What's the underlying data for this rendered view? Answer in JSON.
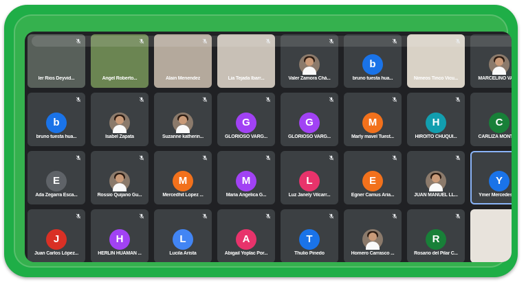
{
  "participants": [
    {
      "name": "ler Rios Deyvid...",
      "type": "video",
      "bg": "#58605a"
    },
    {
      "name": "Angel Roberto...",
      "type": "video",
      "bg": "#6b8552"
    },
    {
      "name": "Alain Menendez",
      "type": "video",
      "bg": "#b4a99c"
    },
    {
      "name": "Lia Tejada Ibarr...",
      "type": "video",
      "bg": "#c8c0b6"
    },
    {
      "name": "Valer Zamora Chá...",
      "type": "photo"
    },
    {
      "name": "bruno tuesta hua...",
      "type": "letter",
      "letter": "b",
      "color": "#1a73e8"
    },
    {
      "name": "Nimeos Tinco Vicu...",
      "type": "video",
      "bg": "#d9d2c6"
    },
    {
      "name": "MARCELINO VAR...",
      "type": "photo"
    },
    {
      "name": "bruno tuesta hua...",
      "type": "letter",
      "letter": "b",
      "color": "#1a73e8"
    },
    {
      "name": "Isabel Zapata",
      "type": "photo"
    },
    {
      "name": "Suzanne katherin...",
      "type": "photo"
    },
    {
      "name": "GLORIOSO VARG...",
      "type": "letter",
      "letter": "G",
      "color": "#a142f4"
    },
    {
      "name": "GLORIOSO VARG...",
      "type": "letter",
      "letter": "G",
      "color": "#a142f4"
    },
    {
      "name": "Marly mavel Tuest...",
      "type": "letter",
      "letter": "M",
      "color": "#f2711c"
    },
    {
      "name": "HIROITO CHUQUI...",
      "type": "letter",
      "letter": "H",
      "color": "#129eaf"
    },
    {
      "name": "CARLIZA MONTO...",
      "type": "letter",
      "letter": "C",
      "color": "#188038"
    },
    {
      "name": "Ada Zegarra Esca...",
      "type": "letter",
      "letter": "E",
      "color": "#5f6368"
    },
    {
      "name": "Rossio Quijano Gu...",
      "type": "photo"
    },
    {
      "name": "Mercedhit Lopez ...",
      "type": "letter",
      "letter": "M",
      "color": "#f2711c"
    },
    {
      "name": "Maria Angelica G...",
      "type": "letter",
      "letter": "M",
      "color": "#a142f4"
    },
    {
      "name": "Luz Janely Vilcarr...",
      "type": "letter",
      "letter": "L",
      "color": "#e8336b"
    },
    {
      "name": "Egner Camus Aria...",
      "type": "letter",
      "letter": "E",
      "color": "#f2711c"
    },
    {
      "name": "JUAN MANUEL LL...",
      "type": "photo"
    },
    {
      "name": "Ymer Mercedes P...",
      "type": "letter",
      "letter": "Y",
      "color": "#1a73e8",
      "active": true
    },
    {
      "name": "Juan Carlos Lòpez...",
      "type": "letter",
      "letter": "J",
      "color": "#d93025"
    },
    {
      "name": "HERLIN HUAMAN ...",
      "type": "letter",
      "letter": "H",
      "color": "#a142f4"
    },
    {
      "name": "Lucila Arista",
      "type": "letter",
      "letter": "L",
      "color": "#4285f4"
    },
    {
      "name": "Abigail Yoplac Por...",
      "type": "letter",
      "letter": "A",
      "color": "#e8336b"
    },
    {
      "name": "Thulio Pinedo",
      "type": "letter",
      "letter": "T",
      "color": "#1a73e8"
    },
    {
      "name": "Homero Carrasco ...",
      "type": "photo"
    },
    {
      "name": "Rosario del Pilar C...",
      "type": "letter",
      "letter": "R",
      "color": "#188038"
    },
    {
      "name": "",
      "type": "video",
      "bg": "#e8e3dc"
    }
  ]
}
